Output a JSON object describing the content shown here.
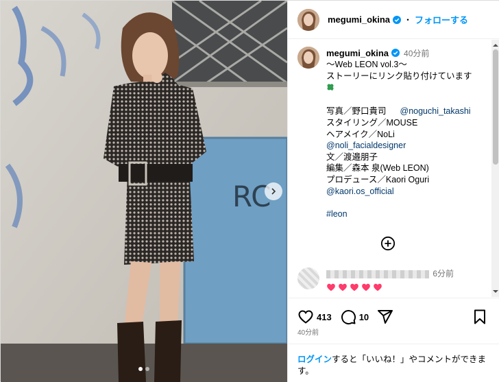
{
  "post": {
    "username": "megumi_okina",
    "follow_label": "フォローする",
    "separator": "・",
    "caption_time": "40分前",
    "caption_lines": [
      {
        "text": "〜Web LEON vol.3〜"
      },
      {
        "text": "ストーリーにリンク貼り付けています"
      }
    ],
    "credits": {
      "photo": "写真／野口貴司",
      "photo_link": "@noguchi_takashi",
      "styling": "スタイリング／MOUSE",
      "hairmake": "ヘアメイク／NoLi",
      "hairmake_link": "@noli_facialdesigner",
      "text": "文／渡邉朋子",
      "edit": "編集／森本 泉(Web LEON)",
      "produce": "プロデュース／Kaori Oguri",
      "produce_link": "@kaori.os_official"
    },
    "hashtag": "#leon",
    "comment": {
      "time": "6分前",
      "hearts": 5,
      "heart_color": "#ff3b6b"
    },
    "likes": "413",
    "comments_count": "10",
    "post_time": "40分前",
    "login": {
      "link": "ログイン",
      "rest": "すると「いいね！」やコメントができます。"
    },
    "carousel": {
      "slides": 2,
      "active": 0
    },
    "colors": {
      "accent": "#0095f6",
      "link": "#00376b",
      "muted": "#737373",
      "verified": "#0095f6"
    },
    "icons": [
      "verified-icon",
      "clover-icon",
      "plus-circle-icon",
      "heart-icon",
      "comment-icon",
      "share-icon",
      "bookmark-icon",
      "chevron-right-icon"
    ]
  }
}
